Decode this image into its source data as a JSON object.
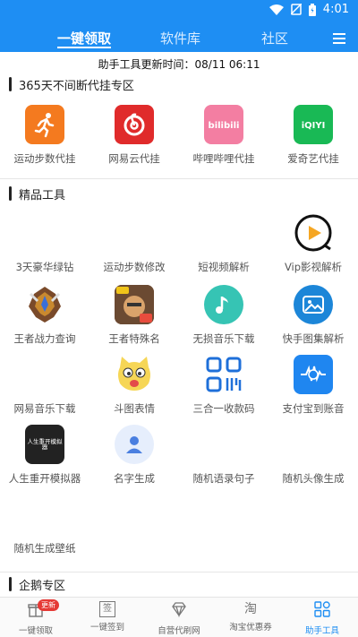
{
  "status_bar": {
    "time": "4:01"
  },
  "tabs": [
    {
      "label": "一键领取"
    },
    {
      "label": "软件库"
    },
    {
      "label": "社区"
    }
  ],
  "update_line": "助手工具更新时间：08/11 06:11",
  "sections": {
    "guaji": {
      "title": "365天不间断代挂专区",
      "items": [
        {
          "label": "运动步数代挂",
          "icon": "running-icon"
        },
        {
          "label": "网易云代挂",
          "icon": "netease-music-icon"
        },
        {
          "label": "哔哩哔哩代挂",
          "icon": "bilibili-icon"
        },
        {
          "label": "爱奇艺代挂",
          "icon": "iqiyi-icon"
        }
      ]
    },
    "tools": {
      "title": "精品工具",
      "items": [
        {
          "label": "3天豪华绿钻",
          "icon": ""
        },
        {
          "label": "运动步数修改",
          "icon": ""
        },
        {
          "label": "短视频解析",
          "icon": ""
        },
        {
          "label": "Vip影视解析",
          "icon": "play-circle-icon"
        },
        {
          "label": "王者战力查询",
          "icon": "hero-emblem-icon"
        },
        {
          "label": "王者特殊名",
          "icon": "hero-portrait-icon"
        },
        {
          "label": "无损音乐下载",
          "icon": "music-note-icon"
        },
        {
          "label": "快手图集解析",
          "icon": "image-gallery-icon"
        },
        {
          "label": "网易音乐下载",
          "icon": ""
        },
        {
          "label": "斗图表情",
          "icon": "cat-face-icon"
        },
        {
          "label": "三合一收款码",
          "icon": "qr-code-icon"
        },
        {
          "label": "支付宝到账音",
          "icon": "alipay-sound-icon"
        },
        {
          "label": "人生重开模拟器",
          "icon": "life-restart-icon",
          "icon_text": "人生重开模拟器"
        },
        {
          "label": "名字生成",
          "icon": "person-icon"
        },
        {
          "label": "随机语录句子",
          "icon": ""
        },
        {
          "label": "随机头像生成",
          "icon": ""
        },
        {
          "label": "随机生成壁纸",
          "icon": ""
        }
      ]
    },
    "qie": {
      "title": "企鹅专区"
    }
  },
  "bottom_nav": [
    {
      "label": "一键领取",
      "icon": "gift-icon",
      "badge": "更新"
    },
    {
      "label": "一键签到",
      "icon": "sign-icon",
      "icon_text": "签"
    },
    {
      "label": "自营代刷网",
      "icon": "diamond-icon"
    },
    {
      "label": "淘宝优惠券",
      "icon": "taobao-icon",
      "icon_text": "淘"
    },
    {
      "label": "助手工具",
      "icon": "grid-tools-icon"
    }
  ],
  "colors": {
    "brand_blue": "#1e8ef3",
    "badge_red": "#e53935"
  }
}
